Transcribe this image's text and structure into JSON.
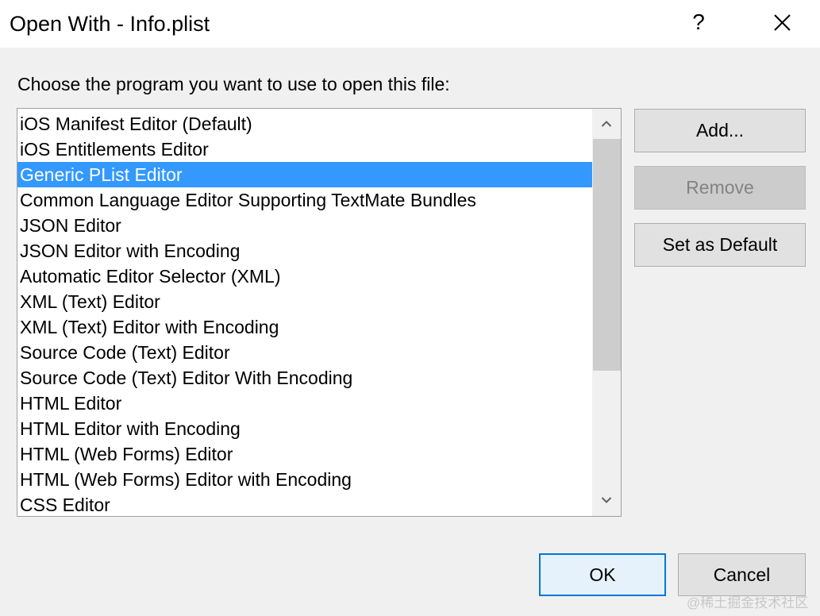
{
  "window": {
    "title": "Open With - Info.plist",
    "help_label": "?",
    "close_icon": "close-icon"
  },
  "prompt": "Choose the program you want to use to open this file:",
  "programs": {
    "selected_index": 2,
    "items": [
      "iOS Manifest Editor (Default)",
      "iOS Entitlements Editor",
      "Generic PList Editor",
      "Common Language Editor Supporting TextMate Bundles",
      "JSON Editor",
      "JSON Editor with Encoding",
      "Automatic Editor Selector (XML)",
      "XML (Text) Editor",
      "XML (Text) Editor with Encoding",
      "Source Code (Text) Editor",
      "Source Code (Text) Editor With Encoding",
      "HTML Editor",
      "HTML Editor with Encoding",
      "HTML (Web Forms) Editor",
      "HTML (Web Forms) Editor with Encoding",
      "CSS Editor"
    ]
  },
  "scrollbar": {
    "up_icon": "chevron-up-icon",
    "down_icon": "chevron-down-icon"
  },
  "buttons": {
    "add": "Add...",
    "remove": "Remove",
    "set_default": "Set as Default",
    "ok": "OK",
    "cancel": "Cancel"
  },
  "watermark": "@稀土掘金技术社区",
  "colors": {
    "selection": "#3399ff",
    "ok_border": "#0078d7"
  }
}
